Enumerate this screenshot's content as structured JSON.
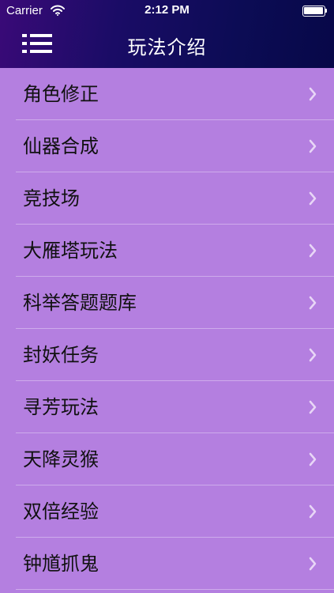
{
  "status_bar": {
    "carrier": "Carrier",
    "time": "2:12 PM",
    "wifi_icon": "wifi-icon",
    "battery_icon": "battery-full-icon"
  },
  "nav": {
    "title": "玩法介绍",
    "menu_icon": "list-menu-icon"
  },
  "list": {
    "items": [
      {
        "label": "角色修正"
      },
      {
        "label": "仙器合成"
      },
      {
        "label": "竞技场"
      },
      {
        "label": "大雁塔玩法"
      },
      {
        "label": "科举答题题库"
      },
      {
        "label": "封妖任务"
      },
      {
        "label": "寻芳玩法"
      },
      {
        "label": "天降灵猴"
      },
      {
        "label": "双倍经验"
      },
      {
        "label": "钟馗抓鬼"
      }
    ],
    "chevron_icon": "chevron-right-icon"
  },
  "colors": {
    "list_background": "#b47fe0",
    "header_start": "#3a0a78",
    "header_end": "#070848",
    "chevron": "#e8d6f6",
    "row_text": "#111111"
  }
}
